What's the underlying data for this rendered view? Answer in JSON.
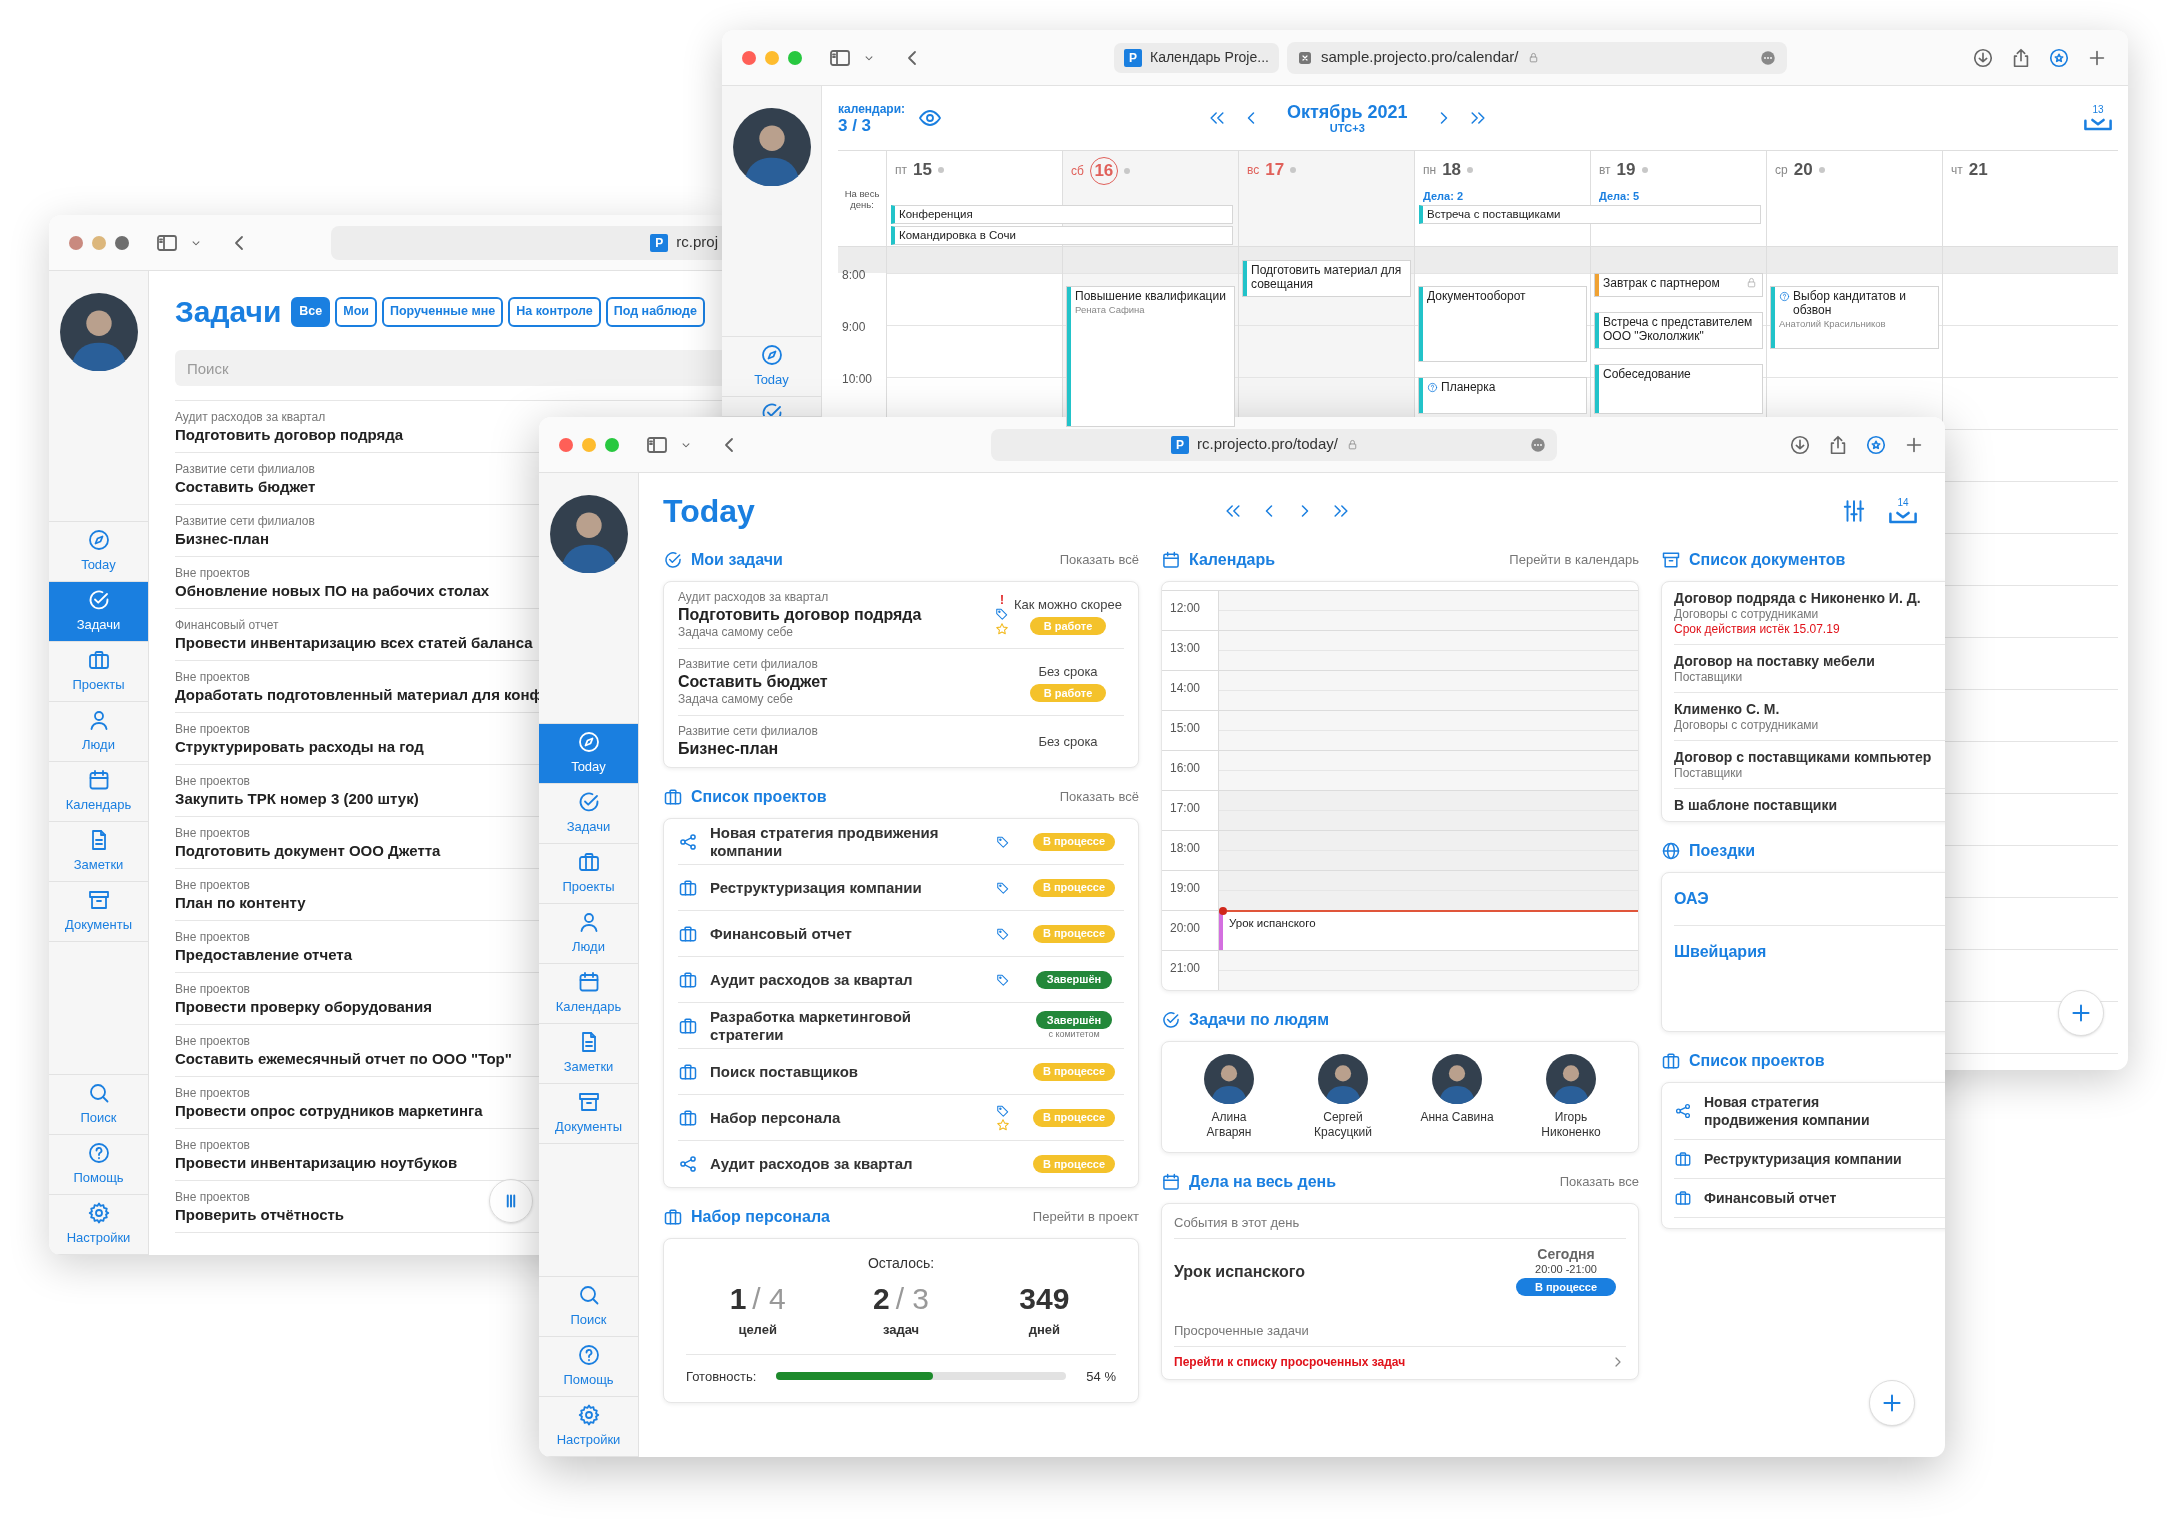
{
  "tasks_window": {
    "focused": false,
    "logo_letter": "P",
    "address": "rc.proj",
    "nav": [
      {
        "kind": "compass",
        "label": "Today",
        "selected": false
      },
      {
        "kind": "check",
        "label": "Задачи",
        "selected": true
      },
      {
        "kind": "briefcase",
        "label": "Проекты",
        "selected": false
      },
      {
        "kind": "person",
        "label": "Люди",
        "selected": false
      },
      {
        "kind": "calendar",
        "label": "Календарь",
        "selected": false
      },
      {
        "kind": "note",
        "label": "Заметки",
        "selected": false
      },
      {
        "kind": "archive",
        "label": "Документы",
        "selected": false
      }
    ],
    "nav_bottom": [
      {
        "kind": "search",
        "label": "Поиск"
      },
      {
        "kind": "help",
        "label": "Помощь"
      },
      {
        "kind": "gear",
        "label": "Настройки"
      }
    ],
    "title": "Задачи",
    "filters": [
      {
        "label": "Все",
        "selected": true
      },
      {
        "label": "Мои",
        "selected": false
      },
      {
        "label": "Порученные мне",
        "selected": false
      },
      {
        "label": "На контроле",
        "selected": false
      },
      {
        "label": "Под наблюде",
        "selected": false
      }
    ],
    "search": {
      "placeholder": "Поиск"
    },
    "tasks": [
      {
        "project": "Аудит расходов за квартал",
        "title": "Подготовить договор подряда"
      },
      {
        "project": "Развитие сети филиалов",
        "title": "Составить бюджет"
      },
      {
        "project": "Развитие сети филиалов",
        "title": "Бизнес-план"
      },
      {
        "project": "Вне проектов",
        "title": "Обновление новых ПО на рабочих столах"
      },
      {
        "project": "Финансовый отчет",
        "title": "Провести инвентаризацию всех статей баланса"
      },
      {
        "project": "Вне проектов",
        "title": "Доработать подготовленный материал для конф"
      },
      {
        "project": "Вне проектов",
        "title": "Структурировать расходы на год"
      },
      {
        "project": "Вне проектов",
        "title": "Закупить ТРК номер 3 (200 штук)"
      },
      {
        "project": "Вне проектов",
        "title": "Подготовить документ ООО Джетта"
      },
      {
        "project": "Вне проектов",
        "title": "План по контенту"
      },
      {
        "project": "Вне проектов",
        "title": "Предоставление отчета"
      },
      {
        "project": "Вне проектов",
        "title": "Провести проверку оборудования"
      },
      {
        "project": "Вне проектов",
        "title": "Составить ежемесячный отчет по ООО \"Тор\""
      },
      {
        "project": "Вне проектов",
        "title": "Провести опрос сотрудников маркетинга"
      },
      {
        "project": "Вне проектов",
        "title": "Провести инвентаризацию ноутбуков"
      },
      {
        "project": "Вне проектов",
        "title": "Проверить отчётность"
      }
    ]
  },
  "calendar_window": {
    "focused": true,
    "logo_letter": "P",
    "tab_title": "Календарь Proje...",
    "address": "sample.projecto.pro/calendar/",
    "nav": [
      {
        "kind": "compass",
        "label": "Today",
        "selected": false
      },
      {
        "kind": "check",
        "selected": false
      }
    ],
    "calendars_label": "календари:",
    "calendars_count": "3 / 3",
    "month": "Октябрь 2021",
    "timezone": "UTC+3",
    "inbox_count": "13",
    "all_day_label": "На весь день:",
    "times": [
      "8:00",
      "9:00",
      "10:00"
    ],
    "days": [
      {
        "weekday": "пт",
        "date": "15",
        "weekend": false,
        "today": false,
        "dot": true,
        "all_day": [
          {
            "title": "Конференция",
            "multi_day": true
          },
          {
            "title": "Командировка в Сочи",
            "multi_day": true
          }
        ]
      },
      {
        "weekday": "сб",
        "date": "16",
        "weekend": true,
        "today": true,
        "dot": true,
        "events": [
          {
            "title": "Повышение квалификации",
            "person": "Рената Сафина",
            "kind": "plain",
            "color": "#22c3c9"
          }
        ]
      },
      {
        "weekday": "вс",
        "date": "17",
        "weekend": true,
        "today": false,
        "dot": true,
        "events": [
          {
            "title": "Подготовить материал для совещания",
            "kind": "plain",
            "color": "#22c3c9"
          }
        ]
      },
      {
        "weekday": "пн",
        "date": "18",
        "weekend": false,
        "today": false,
        "dot": true,
        "note": "Дела: 2",
        "all_day": [
          {
            "title": "Встреча с поставщиками",
            "multi_day": true
          }
        ],
        "events": [
          {
            "title": "Документооборот",
            "kind": "plain",
            "color": "#22c3c9"
          },
          {
            "title": "Планерка",
            "kind": "question",
            "color": "#22c3c9"
          }
        ]
      },
      {
        "weekday": "вт",
        "date": "19",
        "weekend": false,
        "today": false,
        "dot": true,
        "note": "Дела: 5",
        "events": [
          {
            "title": "Завтрак с партнером",
            "kind": "locked",
            "color": "#f0a233"
          },
          {
            "title": "Встреча с представителем ООО \"Экололжик\"",
            "kind": "plain",
            "color": "#22c3c9"
          },
          {
            "title": "Собеседование",
            "kind": "plain",
            "color": "#22c3c9"
          }
        ]
      },
      {
        "weekday": "ср",
        "date": "20",
        "weekend": false,
        "today": false,
        "dot": true,
        "events": [
          {
            "title": "Выбор кандитатов и обзвон",
            "person": "Анатолий Красильников",
            "kind": "question",
            "color": "#22c3c9"
          }
        ]
      },
      {
        "weekday": "чт",
        "date": "21",
        "weekend": false,
        "today": false,
        "dot": false
      }
    ]
  },
  "today_window": {
    "focused": true,
    "logo_letter": "P",
    "address": "rc.projecto.pro/today/",
    "nav": [
      {
        "kind": "compass",
        "label": "Today",
        "selected": true
      },
      {
        "kind": "check",
        "label": "Задачи",
        "selected": false
      },
      {
        "kind": "briefcase",
        "label": "Проекты",
        "selected": false
      },
      {
        "kind": "person",
        "label": "Люди",
        "selected": false
      },
      {
        "kind": "calendar",
        "label": "Календарь",
        "selected": false
      },
      {
        "kind": "note",
        "label": "Заметки",
        "selected": false
      },
      {
        "kind": "archive",
        "label": "Документы",
        "selected": false
      }
    ],
    "nav_bottom": [
      {
        "kind": "search",
        "label": "Поиск"
      },
      {
        "kind": "help",
        "label": "Помощь"
      },
      {
        "kind": "gear",
        "label": "Настройки"
      }
    ],
    "title": "Today",
    "inbox_count": "14",
    "my_tasks": {
      "title": "Мои задачи",
      "link": "Показать всё",
      "items": [
        {
          "project": "Аудит расходов за квартал",
          "title": "Подготовить договор подряда",
          "assignee": "Задача самому себе",
          "due": "Как можно скорее",
          "status": "В работе",
          "priority_mark": "!",
          "tagged": true,
          "starred": true
        },
        {
          "project": "Развитие сети филиалов",
          "title": "Составить бюджет",
          "assignee": "Задача самому себе",
          "due": "Без срока",
          "status": "В работе",
          "tagged": false,
          "starred": false
        },
        {
          "project": "Развитие сети филиалов",
          "title": "Бизнес-план",
          "due": "Без срока",
          "tagged": false,
          "starred": false
        }
      ]
    },
    "projects": {
      "title": "Список проектов",
      "link": "Показать всё",
      "items": [
        {
          "kind": "share",
          "title": "Новая стратегия продвижения компании",
          "status": "В процессе",
          "done": false,
          "tagged": true,
          "starred": false
        },
        {
          "kind": "briefcase",
          "title": "Реструктуризация компании",
          "status": "В процессе",
          "done": false,
          "tagged": true,
          "starred": false
        },
        {
          "kind": "briefcase",
          "title": "Финансовый отчет",
          "status": "В процессе",
          "done": false,
          "tagged": true,
          "starred": false
        },
        {
          "kind": "briefcase",
          "title": "Аудит расходов за квартал",
          "status": "Завершён",
          "done": true,
          "tagged": true,
          "starred": false
        },
        {
          "kind": "briefcase",
          "title": "Разработка маркетинговой стратегии",
          "status": "Завершён",
          "note": "с комитетом",
          "done": true,
          "tagged": false,
          "starred": false
        },
        {
          "kind": "briefcase",
          "title": "Поиск поставщиков",
          "status": "В процессе",
          "done": false,
          "tagged": false,
          "starred": false
        },
        {
          "kind": "briefcase",
          "title": "Набор персонала",
          "status": "В процессе",
          "done": false,
          "tagged": true,
          "starred": true
        },
        {
          "kind": "share",
          "title": "Аудит расходов за квартал",
          "status": "В процессе",
          "done": false,
          "tagged": false,
          "starred": false
        }
      ]
    },
    "project_card": {
      "title": "Набор персонала",
      "link": "Перейти в проект",
      "remaining_label": "Осталось:",
      "stats": [
        {
          "value": "1",
          "total": "/ 4",
          "label": "целей"
        },
        {
          "value": "2",
          "total": "/ 3",
          "label": "задач"
        },
        {
          "value": "349",
          "label": "дней"
        }
      ],
      "progress_label": "Готовность:",
      "level": 0.54,
      "reading": "54 %"
    },
    "calendar": {
      "title": "Календарь",
      "link": "Перейти в календарь",
      "hours": [
        {
          "label": "12:00",
          "now": false
        },
        {
          "label": "13:00",
          "now": false
        },
        {
          "label": "14:00",
          "now": false
        },
        {
          "label": "15:00",
          "now": false
        },
        {
          "label": "16:00",
          "now": false
        },
        {
          "label": "17:00",
          "now": false
        },
        {
          "label": "18:00",
          "now": false
        },
        {
          "label": "19:00",
          "now": false
        },
        {
          "label": "20:00",
          "now": true,
          "events": [
            {
              "title": "Урок испанского",
              "color": "#d46fe0"
            }
          ]
        },
        {
          "label": "21:00",
          "now": false
        }
      ]
    },
    "people": {
      "title": "Задачи по людям",
      "items": [
        {
          "name": "Алина Агварян"
        },
        {
          "name": "Сергей Красуцкий"
        },
        {
          "name": "Анна Савина"
        },
        {
          "name": "Игорь Никоненко"
        }
      ]
    },
    "all_day": {
      "title": "Дела на весь день",
      "link": "Показать все",
      "events_heading": "События в этот день",
      "events": [
        {
          "title": "Урок испанского",
          "day": "Сегодня",
          "time": "20:00 -21:00",
          "status": "В процессе"
        }
      ],
      "overdue_heading": "Просроченные задачи",
      "overdue_link": "Перейти к списку просроченных задач"
    },
    "documents": {
      "title": "Список документов",
      "items": [
        {
          "title": "Договор подряда с Никоненко И. Д.",
          "category": "Договоры с сотрудниками",
          "warning": "Срок действия истёк 15.07.19"
        },
        {
          "title": "Договор на поставку мебели",
          "category": "Поставщики"
        },
        {
          "title": "Клименко С. М.",
          "category": "Договоры с сотрудниками"
        },
        {
          "title": "Договор с поставщиками компьютер",
          "category": "Поставщики"
        },
        {
          "title": "В шаблоне поставщики"
        }
      ]
    },
    "trips": {
      "title": "Поездки",
      "items": [
        "ОАЭ",
        "Швейцария"
      ]
    },
    "projects_short": {
      "title": "Список проектов",
      "items": [
        {
          "kind": "share",
          "title": "Новая стратегия продвижения компании"
        },
        {
          "kind": "briefcase",
          "title": "Реструктуризация компании"
        },
        {
          "kind": "briefcase",
          "title": "Финансовый отчет"
        }
      ]
    }
  }
}
